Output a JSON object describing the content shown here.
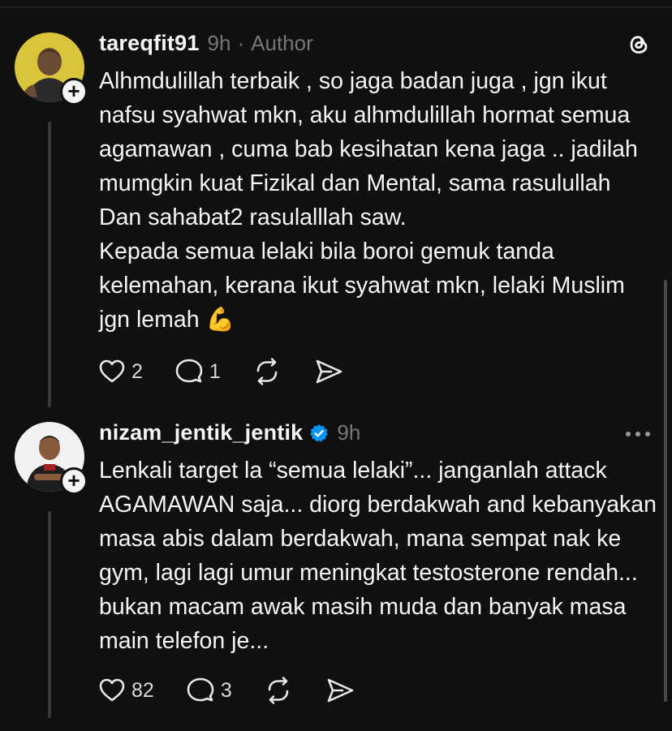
{
  "posts": [
    {
      "username": "tareqfit91",
      "time": "9h",
      "separator": "·",
      "tag": "Author",
      "corner_icon": "threads-logo-icon",
      "body": [
        "Alhmdulillah terbaik , so jaga badan juga , jgn ikut nafsu syahwat mkn, aku alhmdulillah hormat semua agamawan , cuma bab kesihatan kena jaga .. jadilah mumgkin kuat Fizikal dan Mental, sama rasulullah Dan sahabat2 rasulalllah saw.",
        "Kepada semua lelaki bila boroi gemuk tanda kelemahan, kerana ikut syahwat mkn, lelaki Muslim jgn lemah 💪"
      ],
      "likes": "2",
      "replies": "1"
    },
    {
      "username": "nizam_jentik_jentik",
      "verified": true,
      "time": "9h",
      "corner_icon": "more-options-icon",
      "body": [
        "Lenkali target la “semua lelaki”... janganlah attack AGAMAWAN saja... diorg berdakwah and kebanyakan masa abis dalam berdakwah, mana sempat nak ke gym, lagi lagi umur meningkat testosterone rendah... bukan macam awak masih muda dan banyak masa main telefon je..."
      ],
      "likes": "82",
      "replies": "3"
    }
  ],
  "colors": {
    "background": "#101010",
    "text": "#f3f5f7",
    "muted": "#777777",
    "verified": "#0095f6"
  }
}
